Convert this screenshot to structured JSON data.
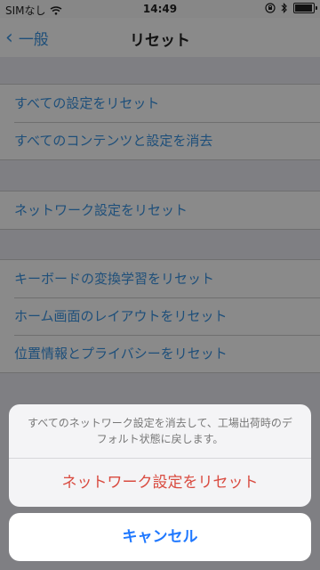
{
  "status": {
    "carrier": "SIMなし",
    "time": "14:49",
    "icons": [
      "wifi-icon",
      "rotation-lock-icon",
      "bluetooth-icon",
      "battery-icon"
    ]
  },
  "nav": {
    "back_label": "一般",
    "title": "リセット"
  },
  "groups": [
    {
      "items": [
        "すべての設定をリセット",
        "すべてのコンテンツと設定を消去"
      ]
    },
    {
      "items": [
        "ネットワーク設定をリセット"
      ]
    },
    {
      "items": [
        "キーボードの変換学習をリセット",
        "ホーム画面のレイアウトをリセット",
        "位置情報とプライバシーをリセット"
      ]
    }
  ],
  "sheet": {
    "message": "すべてのネットワーク設定を消去して、工場出荷時のデフォルト状態に戻します。",
    "action_label": "ネットワーク設定をリセット",
    "cancel_label": "キャンセル"
  },
  "colors": {
    "link": "#1e4f7a",
    "destructive": "#d94b40",
    "cancel": "#1f78ff"
  }
}
